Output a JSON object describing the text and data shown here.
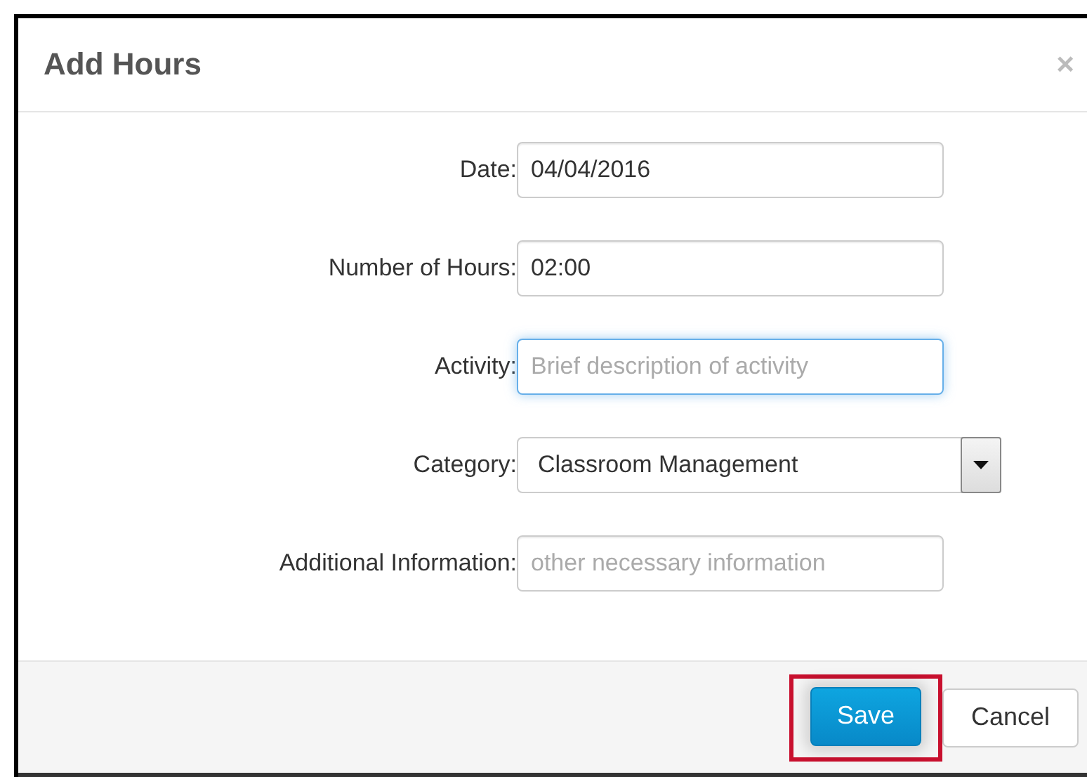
{
  "dialog": {
    "title": "Add Hours",
    "close": "×"
  },
  "fields": [
    {
      "kind": "text",
      "label": "Date:",
      "value": "04/04/2016",
      "focused": false
    },
    {
      "kind": "text",
      "label": "Number of Hours:",
      "value": "02:00",
      "focused": false
    },
    {
      "kind": "text",
      "label": "Activity:",
      "placeholder": "Brief description of activity",
      "focused": true
    },
    {
      "kind": "select",
      "label": "Category:",
      "value": "Classroom Management",
      "focused": false
    },
    {
      "kind": "text",
      "label": "Additional Information:",
      "placeholder": "other necessary information",
      "focused": false
    }
  ],
  "buttons": [
    {
      "label": "Save",
      "kind": "primary",
      "highlighted": true
    },
    {
      "label": "Cancel",
      "kind": "default",
      "highlighted": false
    }
  ]
}
